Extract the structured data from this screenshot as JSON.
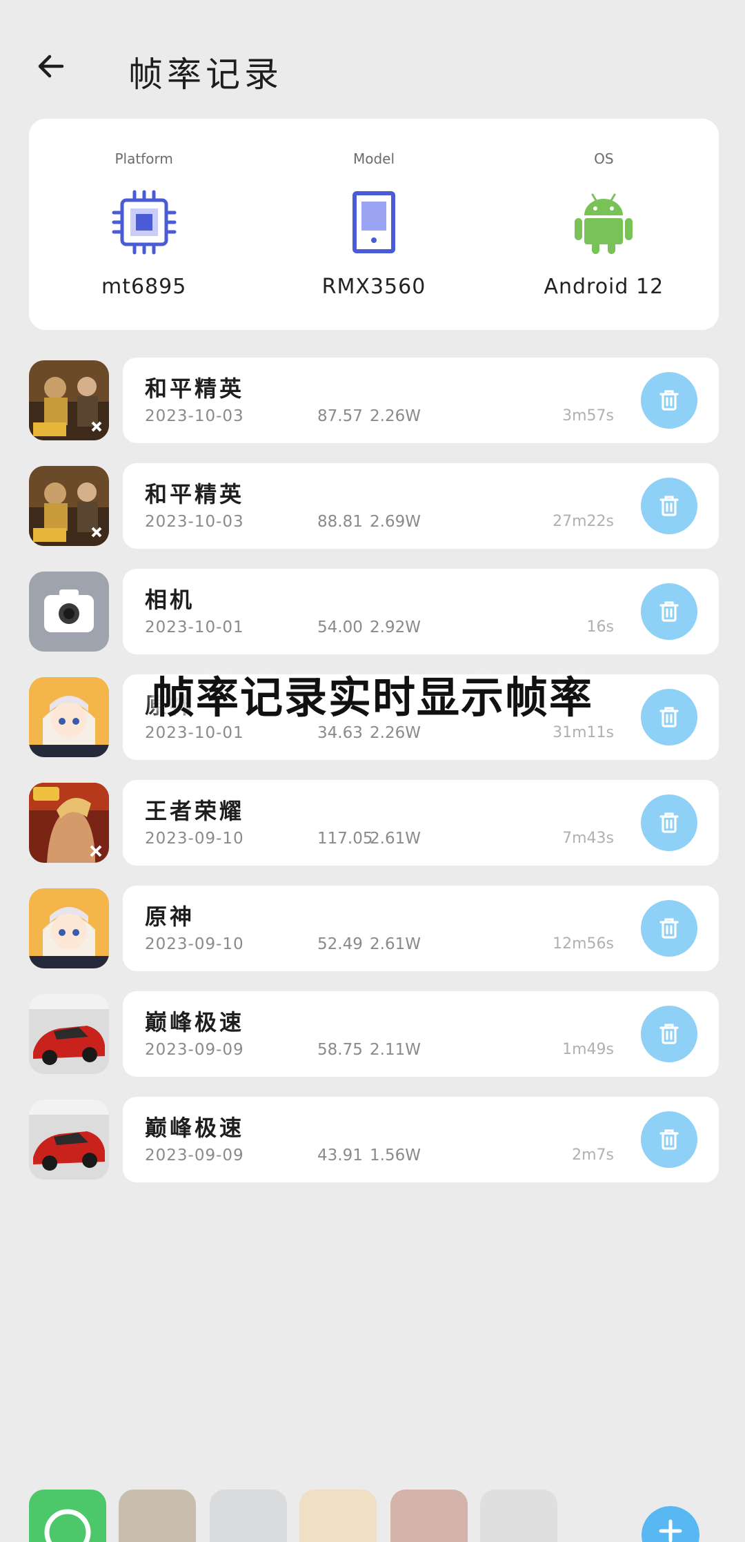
{
  "header": {
    "title": "帧率记录"
  },
  "device": {
    "platform": {
      "caption": "Platform",
      "value": "mt6895",
      "icon": "chip-icon"
    },
    "model": {
      "caption": "Model",
      "value": "RMX3560",
      "icon": "phone-icon"
    },
    "os": {
      "caption": "OS",
      "value": "Android 12",
      "icon": "android-icon"
    }
  },
  "records": [
    {
      "name": "和平精英",
      "date": "2023-10-03",
      "fps": "87.57",
      "power": "2.26W",
      "duration": "3m57s",
      "app": "peace-elite"
    },
    {
      "name": "和平精英",
      "date": "2023-10-03",
      "fps": "88.81",
      "power": "2.69W",
      "duration": "27m22s",
      "app": "peace-elite"
    },
    {
      "name": "相机",
      "date": "2023-10-01",
      "fps": "54.00",
      "power": "2.92W",
      "duration": "16s",
      "app": "camera"
    },
    {
      "name": "原神",
      "date": "2023-10-01",
      "fps": "34.63",
      "power": "2.26W",
      "duration": "31m11s",
      "app": "genshin"
    },
    {
      "name": "王者荣耀",
      "date": "2023-09-10",
      "fps": "117.05",
      "power": "2.61W",
      "duration": "7m43s",
      "app": "honor-of-kings"
    },
    {
      "name": "原神",
      "date": "2023-09-10",
      "fps": "52.49",
      "power": "2.61W",
      "duration": "12m56s",
      "app": "genshin"
    },
    {
      "name": "巅峰极速",
      "date": "2023-09-09",
      "fps": "58.75",
      "power": "2.11W",
      "duration": "1m49s",
      "app": "racing"
    },
    {
      "name": "巅峰极速",
      "date": "2023-09-09",
      "fps": "43.91",
      "power": "1.56W",
      "duration": "2m7s",
      "app": "racing"
    }
  ],
  "overlay": {
    "caption": "帧率记录实时显示帧率"
  },
  "colors": {
    "accent": "#8fd0f7",
    "chip": "#4a5bd6",
    "android": "#78c257",
    "background": "#ebebeb"
  }
}
